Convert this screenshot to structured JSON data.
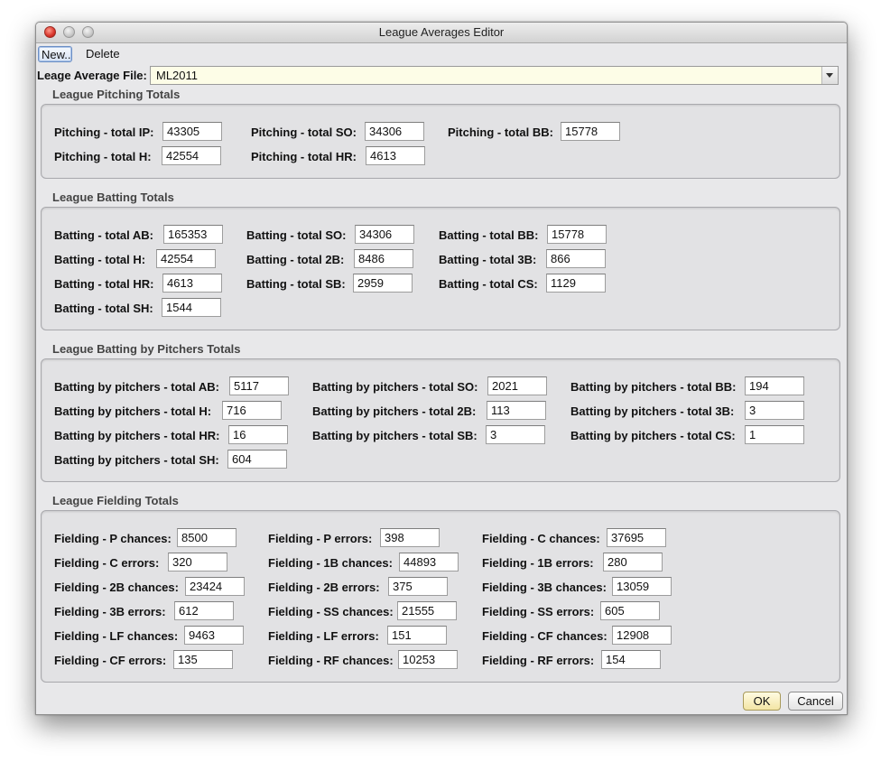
{
  "window": {
    "title": "League Averages Editor"
  },
  "toolbar": {
    "new_label": "New..",
    "delete_label": "Delete"
  },
  "file": {
    "label": "Leage Average File:",
    "value": "ML2011"
  },
  "pitching": {
    "title": "League Pitching Totals",
    "fields": [
      {
        "label": "Pitching - total IP:",
        "value": "43305"
      },
      {
        "label": "Pitching - total SO:",
        "value": "34306"
      },
      {
        "label": "Pitching - total BB:",
        "value": "15778"
      },
      {
        "label": "Pitching - total H:",
        "value": "42554"
      },
      {
        "label": "Pitching - total HR:",
        "value": "4613"
      }
    ]
  },
  "batting": {
    "title": "League Batting Totals",
    "fields": [
      {
        "label": "Batting - total AB:",
        "value": "165353"
      },
      {
        "label": "Batting - total SO:",
        "value": "34306"
      },
      {
        "label": "Batting - total BB:",
        "value": "15778"
      },
      {
        "label": "Batting - total H:",
        "value": "42554"
      },
      {
        "label": "Batting - total 2B:",
        "value": "8486"
      },
      {
        "label": "Batting - total 3B:",
        "value": "866"
      },
      {
        "label": "Batting - total HR:",
        "value": "4613"
      },
      {
        "label": "Batting - total SB:",
        "value": "2959"
      },
      {
        "label": "Batting - total CS:",
        "value": "1129"
      },
      {
        "label": "Batting - total SH:",
        "value": "1544"
      }
    ]
  },
  "pitcher_batting": {
    "title": "League Batting by Pitchers Totals",
    "fields": [
      {
        "label": "Batting by pitchers - total AB:",
        "value": "5117"
      },
      {
        "label": "Batting by pitchers - total SO:",
        "value": "2021"
      },
      {
        "label": "Batting by pitchers - total BB:",
        "value": "194"
      },
      {
        "label": "Batting by pitchers - total H:",
        "value": "716"
      },
      {
        "label": "Batting by pitchers - total 2B:",
        "value": "113"
      },
      {
        "label": "Batting by pitchers - total 3B:",
        "value": "3"
      },
      {
        "label": "Batting by pitchers - total HR:",
        "value": "16"
      },
      {
        "label": "Batting by pitchers - total SB:",
        "value": "3"
      },
      {
        "label": "Batting by pitchers - total CS:",
        "value": "1"
      },
      {
        "label": "Batting by pitchers - total SH:",
        "value": "604"
      }
    ]
  },
  "fielding": {
    "title": "League Fielding Totals",
    "fields": [
      {
        "label": "Fielding - P chances:",
        "value": "8500"
      },
      {
        "label": "Fielding - P errors:",
        "value": "398"
      },
      {
        "label": "Fielding - C chances:",
        "value": "37695"
      },
      {
        "label": "Fielding - C errors:",
        "value": "320"
      },
      {
        "label": "Fielding - 1B chances:",
        "value": "44893"
      },
      {
        "label": "Fielding - 1B errors:",
        "value": "280"
      },
      {
        "label": "Fielding - 2B chances:",
        "value": "23424"
      },
      {
        "label": "Fielding - 2B errors:",
        "value": "375"
      },
      {
        "label": "Fielding - 3B chances:",
        "value": "13059"
      },
      {
        "label": "Fielding - 3B errors:",
        "value": "612"
      },
      {
        "label": "Fielding - SS chances:",
        "value": "21555"
      },
      {
        "label": "Fielding - SS errors:",
        "value": "605"
      },
      {
        "label": "Fielding - LF chances:",
        "value": "9463"
      },
      {
        "label": "Fielding - LF errors:",
        "value": "151"
      },
      {
        "label": "Fielding - CF chances:",
        "value": "12908"
      },
      {
        "label": "Fielding - CF errors:",
        "value": "135"
      },
      {
        "label": "Fielding - RF chances:",
        "value": "10253"
      },
      {
        "label": "Fielding - RF errors:",
        "value": "154"
      }
    ]
  },
  "footer": {
    "ok_label": "OK",
    "cancel_label": "Cancel"
  }
}
